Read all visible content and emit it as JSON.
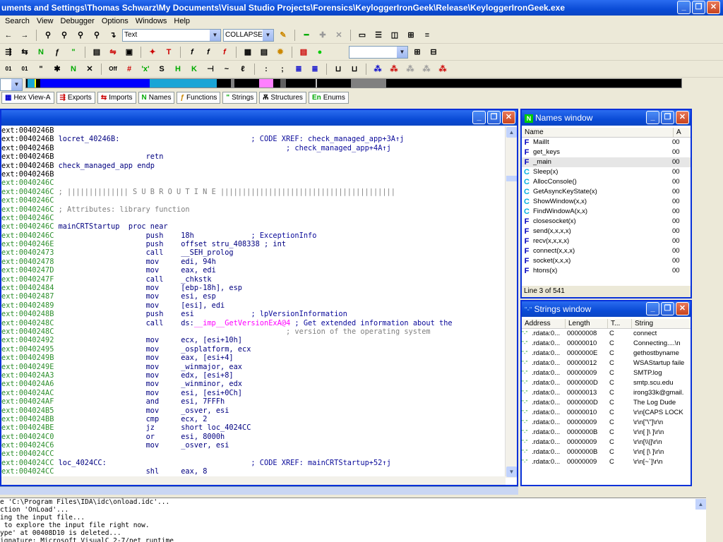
{
  "window": {
    "title": "uments and Settings\\Thomas Schwarz\\My Documents\\Visual Studio Projects\\Forensics\\KeyloggerIronGeek\\Release\\KeyloggerIronGeek.exe"
  },
  "menu": [
    "Search",
    "View",
    "Debugger",
    "Options",
    "Windows",
    "Help"
  ],
  "toolbar": {
    "text_combo": "Text",
    "collapse_combo": "COLLAPSE"
  },
  "tabs": [
    {
      "label": "Hex View-A",
      "icon": "hex-icon"
    },
    {
      "label": "Exports",
      "icon": "exports-icon"
    },
    {
      "label": "Imports",
      "icon": "imports-icon"
    },
    {
      "label": "Names",
      "icon": "names-icon"
    },
    {
      "label": "Functions",
      "icon": "functions-icon"
    },
    {
      "label": "Strings",
      "icon": "strings-icon"
    },
    {
      "label": "Structures",
      "icon": "structures-icon"
    },
    {
      "label": "Enums",
      "icon": "enums-icon"
    }
  ],
  "disasm": [
    {
      "a": "ext:0040246B",
      "g": false,
      "l": "",
      "m": "",
      "o": "",
      "c": ""
    },
    {
      "a": "ext:0040246B",
      "g": false,
      "l": "locret_40246B:",
      "m": "",
      "o": "",
      "c": "; CODE XREF: check_managed_app+3A↑j"
    },
    {
      "a": "ext:0040246B",
      "g": false,
      "l": "",
      "m": "",
      "o": "",
      "c": "; check_managed_app+4A↑j"
    },
    {
      "a": "ext:0040246B",
      "g": false,
      "l": "",
      "m": "retn",
      "o": "",
      "c": ""
    },
    {
      "a": "ext:0040246B",
      "g": false,
      "l": "check_managed_app endp",
      "m": "",
      "o": "",
      "c": ""
    },
    {
      "a": "ext:0040246B",
      "g": false,
      "l": "",
      "m": "",
      "o": "",
      "c": ""
    },
    {
      "a": "ext:0040246C",
      "g": true,
      "l": "",
      "m": "",
      "o": "",
      "c": ""
    },
    {
      "a": "ext:0040246C",
      "g": true,
      "l": "; |||||||||||||| S U B R O U T I N E ||||||||||||||||||||||||||||||||||||||||",
      "m": "",
      "o": "",
      "c": "",
      "sub": true
    },
    {
      "a": "ext:0040246C",
      "g": true,
      "l": "",
      "m": "",
      "o": "",
      "c": ""
    },
    {
      "a": "ext:0040246C",
      "g": true,
      "l": "; Attributes: library function",
      "m": "",
      "o": "",
      "c": "",
      "sub": true
    },
    {
      "a": "ext:0040246C",
      "g": true,
      "l": "",
      "m": "",
      "o": "",
      "c": ""
    },
    {
      "a": "ext:0040246C",
      "g": true,
      "l": "mainCRTStartup",
      "m": "proc near",
      "o": "",
      "c": "",
      "procline": true
    },
    {
      "a": "ext:0040246C",
      "g": true,
      "l": "",
      "m": "push",
      "o": "18h",
      "c": "; ExceptionInfo"
    },
    {
      "a": "ext:0040246E",
      "g": true,
      "l": "",
      "m": "push",
      "o": "offset stru_408338 ; int",
      "c": ""
    },
    {
      "a": "ext:00402473",
      "g": true,
      "l": "",
      "m": "call",
      "o": "__SEH_prolog",
      "c": ""
    },
    {
      "a": "ext:00402478",
      "g": true,
      "l": "",
      "m": "mov",
      "o": "edi, 94h",
      "c": ""
    },
    {
      "a": "ext:0040247D",
      "g": true,
      "l": "",
      "m": "mov",
      "o": "eax, edi",
      "c": ""
    },
    {
      "a": "ext:0040247F",
      "g": true,
      "l": "",
      "m": "call",
      "o": "_chkstk",
      "c": ""
    },
    {
      "a": "ext:00402484",
      "g": true,
      "l": "",
      "m": "mov",
      "o": "[ebp-18h], esp",
      "c": ""
    },
    {
      "a": "ext:00402487",
      "g": true,
      "l": "",
      "m": "mov",
      "o": "esi, esp",
      "c": ""
    },
    {
      "a": "ext:00402489",
      "g": true,
      "l": "",
      "m": "mov",
      "o": "[esi], edi",
      "c": ""
    },
    {
      "a": "ext:0040248B",
      "g": true,
      "l": "",
      "m": "push",
      "o": "esi",
      "c": "; lpVersionInformation"
    },
    {
      "a": "ext:0040248C",
      "g": true,
      "l": "",
      "m": "call",
      "o": "ds:",
      "imp": "__imp__GetVersionExA@4",
      "c": " ; Get extended information about the"
    },
    {
      "a": "ext:0040248C",
      "g": true,
      "l": "",
      "m": "",
      "o": "",
      "c": "; version of the operating system",
      "cgray": true
    },
    {
      "a": "ext:00402492",
      "g": true,
      "l": "",
      "m": "mov",
      "o": "ecx, [esi+10h]",
      "c": ""
    },
    {
      "a": "ext:00402495",
      "g": true,
      "l": "",
      "m": "mov",
      "o": "_osplatform, ecx",
      "c": ""
    },
    {
      "a": "ext:0040249B",
      "g": true,
      "l": "",
      "m": "mov",
      "o": "eax, [esi+4]",
      "c": ""
    },
    {
      "a": "ext:0040249E",
      "g": true,
      "l": "",
      "m": "mov",
      "o": "_winmajor, eax",
      "c": ""
    },
    {
      "a": "ext:004024A3",
      "g": true,
      "l": "",
      "m": "mov",
      "o": "edx, [esi+8]",
      "c": ""
    },
    {
      "a": "ext:004024A6",
      "g": true,
      "l": "",
      "m": "mov",
      "o": "_winminor, edx",
      "c": ""
    },
    {
      "a": "ext:004024AC",
      "g": true,
      "l": "",
      "m": "mov",
      "o": "esi, [esi+0Ch]",
      "c": ""
    },
    {
      "a": "ext:004024AF",
      "g": true,
      "l": "",
      "m": "and",
      "o": "esi, 7FFFh",
      "c": ""
    },
    {
      "a": "ext:004024B5",
      "g": true,
      "l": "",
      "m": "mov",
      "o": "_osver, esi",
      "c": ""
    },
    {
      "a": "ext:004024BB",
      "g": true,
      "l": "",
      "m": "cmp",
      "o": "ecx, 2",
      "c": ""
    },
    {
      "a": "ext:004024BE",
      "g": true,
      "l": "",
      "m": "jz",
      "o": "short loc_4024CC",
      "c": ""
    },
    {
      "a": "ext:004024C0",
      "g": true,
      "l": "",
      "m": "or",
      "o": "esi, 8000h",
      "c": ""
    },
    {
      "a": "ext:004024C6",
      "g": true,
      "l": "",
      "m": "mov",
      "o": "_osver, esi",
      "c": ""
    },
    {
      "a": "ext:004024CC",
      "g": true,
      "l": "",
      "m": "",
      "o": "",
      "c": ""
    },
    {
      "a": "ext:004024CC",
      "g": true,
      "l": "loc_4024CC:",
      "m": "",
      "o": "",
      "c": "; CODE XREF: mainCRTStartup+52↑j"
    },
    {
      "a": "ext:004024CC",
      "g": true,
      "l": "",
      "m": "shl",
      "o": "eax, 8",
      "c": ""
    }
  ],
  "names_window": {
    "title": "Names window",
    "col_name": "Name",
    "col_addr": "A",
    "items": [
      {
        "t": "F",
        "n": "MailIt",
        "a": "00"
      },
      {
        "t": "F",
        "n": "get_keys",
        "a": "00"
      },
      {
        "t": "F",
        "n": "_main",
        "a": "00",
        "sel": true
      },
      {
        "t": "C",
        "n": "Sleep(x)",
        "a": "00"
      },
      {
        "t": "C",
        "n": "AllocConsole()",
        "a": "00"
      },
      {
        "t": "C",
        "n": "GetAsyncKeyState(x)",
        "a": "00"
      },
      {
        "t": "C",
        "n": "ShowWindow(x,x)",
        "a": "00"
      },
      {
        "t": "C",
        "n": "FindWindowA(x,x)",
        "a": "00"
      },
      {
        "t": "F",
        "n": "closesocket(x)",
        "a": "00"
      },
      {
        "t": "F",
        "n": "send(x,x,x,x)",
        "a": "00"
      },
      {
        "t": "F",
        "n": "recv(x,x,x,x)",
        "a": "00"
      },
      {
        "t": "F",
        "n": "connect(x,x,x)",
        "a": "00"
      },
      {
        "t": "F",
        "n": "socket(x,x,x)",
        "a": "00"
      },
      {
        "t": "F",
        "n": "htons(x)",
        "a": "00"
      }
    ],
    "status": "Line 3 of 541"
  },
  "strings_window": {
    "title": "Strings window",
    "cols": [
      "Address",
      "Length",
      "T...",
      "String"
    ],
    "items": [
      {
        "a": ".rdata:0...",
        "l": "00000008",
        "t": "C",
        "s": "connect"
      },
      {
        "a": ".rdata:0...",
        "l": "00000010",
        "t": "C",
        "s": "Connecting....\\n"
      },
      {
        "a": ".rdata:0...",
        "l": "0000000E",
        "t": "C",
        "s": "gethostbyname"
      },
      {
        "a": ".rdata:0...",
        "l": "00000012",
        "t": "C",
        "s": "WSAStartup faile"
      },
      {
        "a": ".rdata:0...",
        "l": "00000009",
        "t": "C",
        "s": "SMTP.log"
      },
      {
        "a": ".rdata:0...",
        "l": "0000000D",
        "t": "C",
        "s": "smtp.scu.edu"
      },
      {
        "a": ".rdata:0...",
        "l": "00000013",
        "t": "C",
        "s": "irong33k@gmail."
      },
      {
        "a": ".rdata:0...",
        "l": "0000000D",
        "t": "C",
        "s": "The Log Dude"
      },
      {
        "a": ".rdata:0...",
        "l": "00000010",
        "t": "C",
        "s": "\\r\\n[CAPS LOCK"
      },
      {
        "a": ".rdata:0...",
        "l": "00000009",
        "t": "C",
        "s": "\\r\\n[\"\\\"]\\r\\n"
      },
      {
        "a": ".rdata:0...",
        "l": "0000000B",
        "t": "C",
        "s": "\\r\\n[ ]\\ ]\\r\\n"
      },
      {
        "a": ".rdata:0...",
        "l": "00000009",
        "t": "C",
        "s": "\\r\\n[\\\\|]\\r\\n"
      },
      {
        "a": ".rdata:0...",
        "l": "0000000B",
        "t": "C",
        "s": "\\r\\n[ [\\ ]\\r\\n"
      },
      {
        "a": ".rdata:0...",
        "l": "00000009",
        "t": "C",
        "s": "\\r\\n[~`]\\r\\n"
      }
    ]
  },
  "output": [
    "e 'C:\\Program Files\\IDA\\idc\\onload.idc'...",
    "ction 'OnLoad'...",
    "ing the input file...",
    " to explore the input file right now.",
    "ype' at 00408D10 is deleted...",
    "ignature: Microsoft VisualC 2-7/net runtime",
    "ype information..."
  ]
}
